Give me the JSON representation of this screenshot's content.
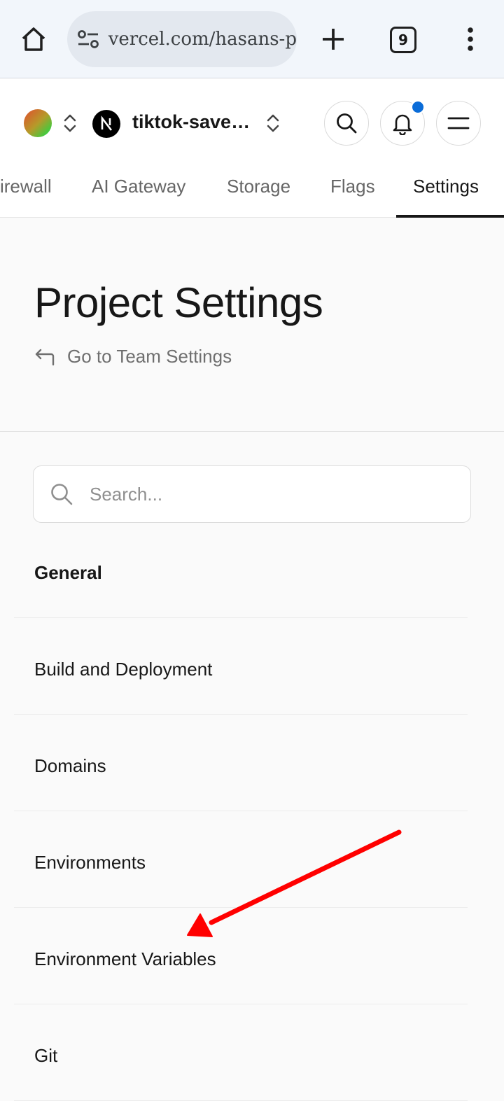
{
  "browser": {
    "url": "vercel.com/hasans-p",
    "tab_count": "9"
  },
  "header": {
    "project_name": "tiktok-save…",
    "nav_tabs": [
      {
        "label": "irewall"
      },
      {
        "label": "AI Gateway"
      },
      {
        "label": "Storage"
      },
      {
        "label": "Flags"
      },
      {
        "label": "Settings",
        "active": true
      }
    ],
    "notification_dot_color": "#0a6cd8"
  },
  "page": {
    "title": "Project Settings",
    "back_link": "Go to Team Settings"
  },
  "search": {
    "placeholder": "Search..."
  },
  "menu": {
    "items": [
      {
        "label": "General",
        "selected": true
      },
      {
        "label": "Build and Deployment"
      },
      {
        "label": "Domains"
      },
      {
        "label": "Environments"
      },
      {
        "label": "Environment Variables"
      },
      {
        "label": "Git"
      }
    ]
  },
  "annotation": {
    "arrow_color": "#ff0000"
  }
}
